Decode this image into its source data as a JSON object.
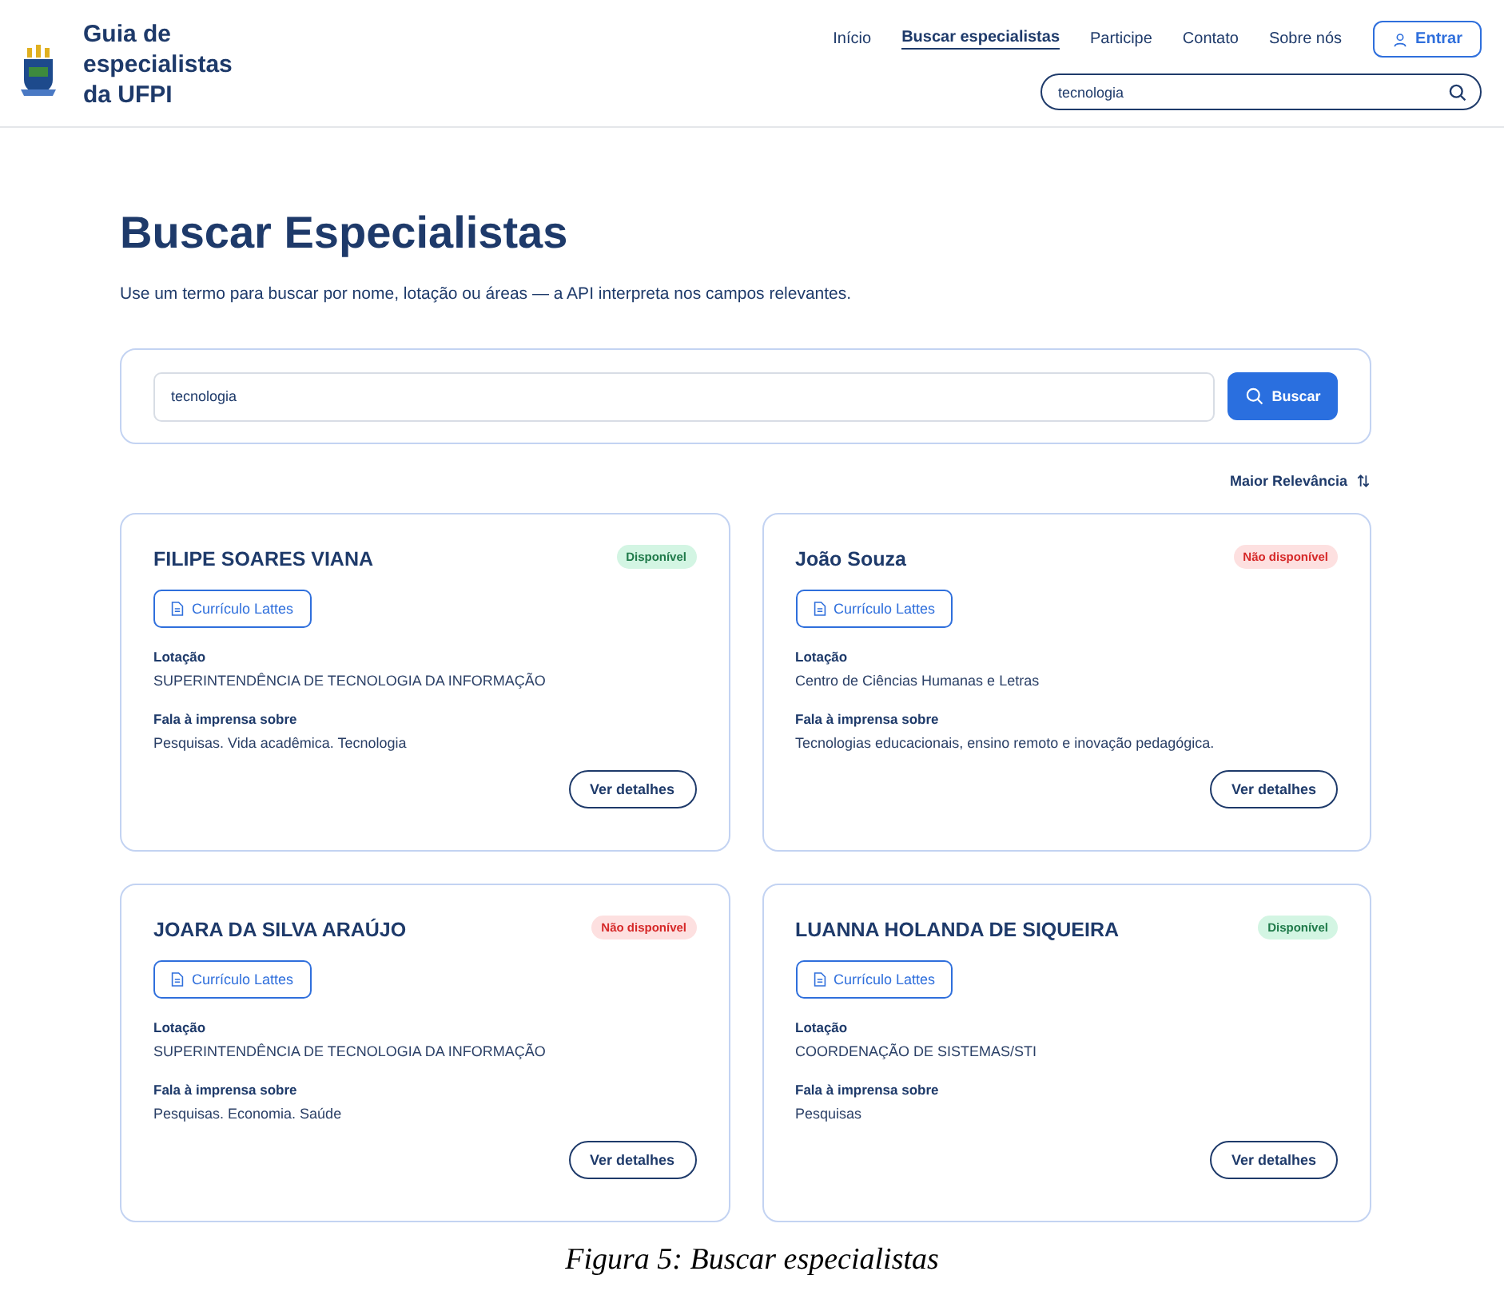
{
  "header": {
    "site_title": "Guia de especialistas da UFPI",
    "nav": [
      {
        "label": "Início",
        "selected": false
      },
      {
        "label": "Buscar especialistas",
        "selected": true
      },
      {
        "label": "Participe",
        "selected": false
      },
      {
        "label": "Contato",
        "selected": false
      },
      {
        "label": "Sobre nós",
        "selected": false
      }
    ],
    "login_button": "Entrar",
    "search": {
      "value": "tecnologia"
    }
  },
  "page": {
    "title": "Buscar Especialistas",
    "subtitle": "Use um termo para buscar por nome, lotação ou áreas — a API interpreta nos campos relevantes.",
    "search": {
      "value": "tecnologia",
      "button": "Buscar"
    },
    "sort": "Maior Relevância"
  },
  "results": [
    {
      "name": "FILIPE SOARES VIANA",
      "status": "Disponível",
      "available": true,
      "lattes": "Currículo Lattes",
      "lotacao_label": "Lotação",
      "lotacao": "SUPERINTENDÊNCIA DE TECNOLOGIA DA INFORMAÇÃO",
      "topics_label": "Fala à imprensa sobre",
      "topics": "Pesquisas. Vida acadêmica. Tecnologia",
      "details": "Ver detalhes"
    },
    {
      "name": "João Souza",
      "status": "Não disponível",
      "available": false,
      "lattes": "Currículo Lattes",
      "lotacao_label": "Lotação",
      "lotacao": "Centro de Ciências Humanas e Letras",
      "topics_label": "Fala à imprensa sobre",
      "topics": "Tecnologias educacionais, ensino remoto e inovação pedagógica.",
      "details": "Ver detalhes"
    },
    {
      "name": "JOARA DA SILVA ARAÚJO",
      "status": "Não disponível",
      "available": false,
      "lattes": "Currículo Lattes",
      "lotacao_label": "Lotação",
      "lotacao": "SUPERINTENDÊNCIA DE TECNOLOGIA DA INFORMAÇÃO",
      "topics_label": "Fala à imprensa sobre",
      "topics": "Pesquisas. Economia. Saúde",
      "details": "Ver detalhes"
    },
    {
      "name": "LUANNA HOLANDA DE SIQUEIRA",
      "status": "Disponível",
      "available": true,
      "lattes": "Currículo Lattes",
      "lotacao_label": "Lotação",
      "lotacao": "COORDENAÇÃO DE SISTEMAS/STI",
      "topics_label": "Fala à imprensa sobre",
      "topics": "Pesquisas",
      "details": "Ver detalhes"
    }
  ],
  "caption": "Figura 5: Buscar especialistas"
}
